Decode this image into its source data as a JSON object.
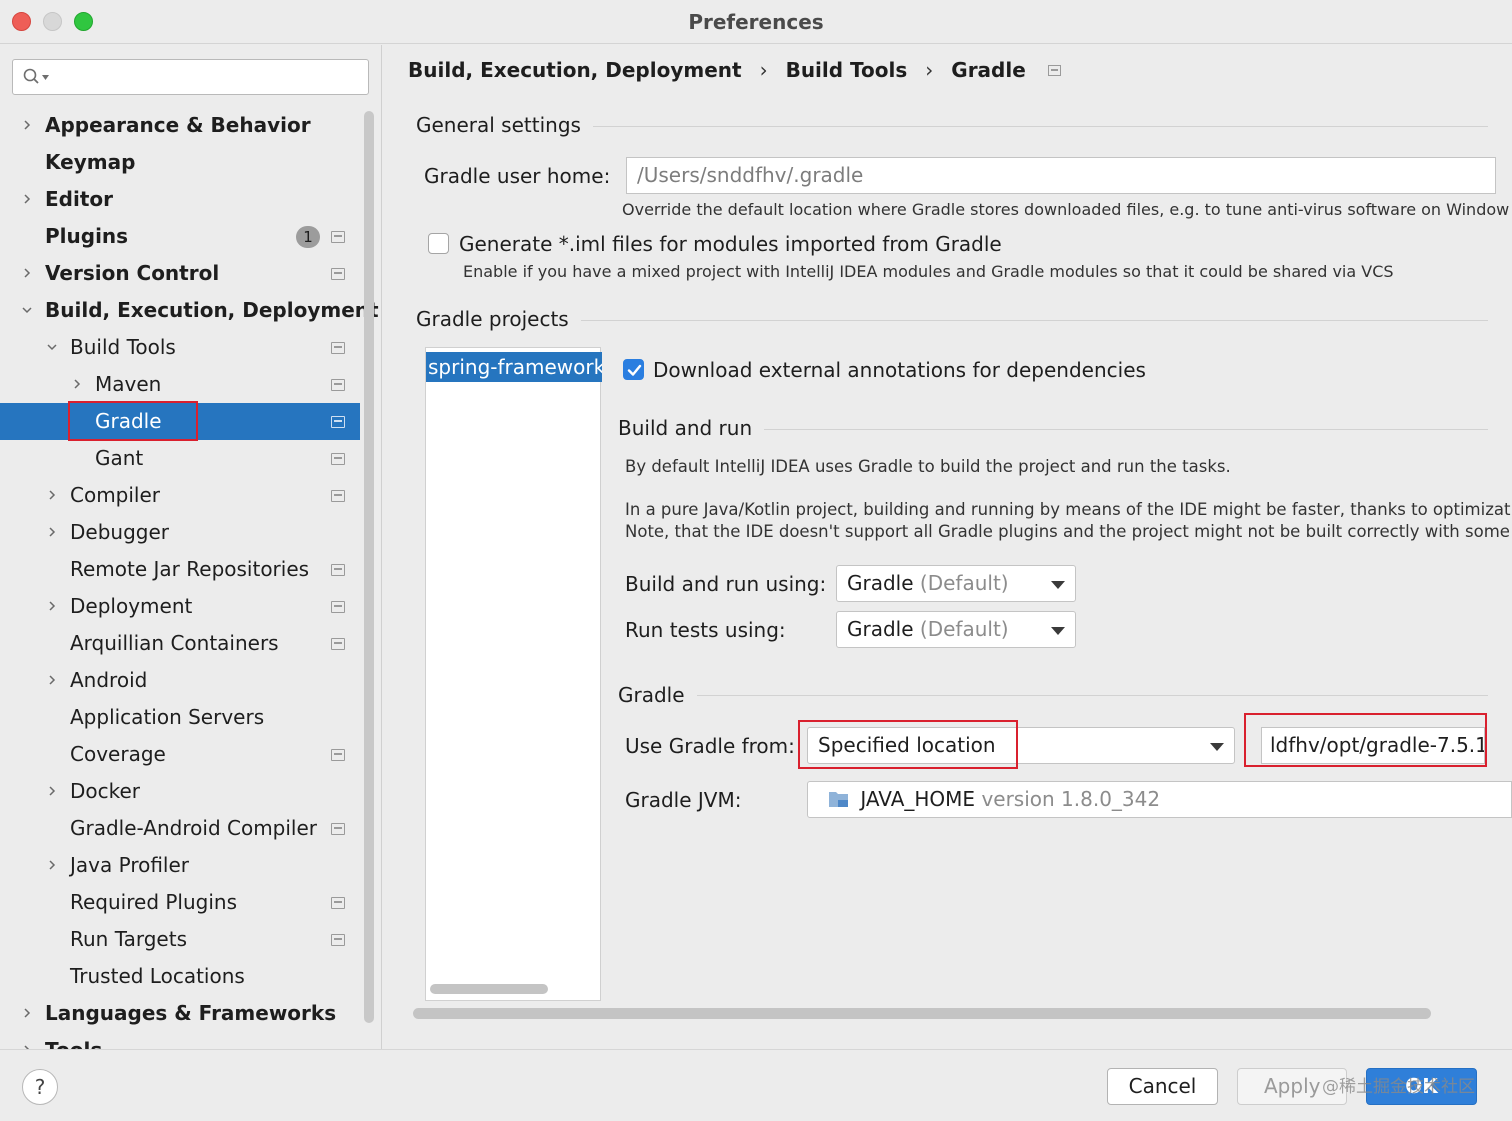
{
  "window": {
    "title": "Preferences",
    "colors": {
      "selection": "#2675bf",
      "highlight_box": "#d9202e",
      "checkbox_checked": "#2a7ee0",
      "ok_button": "#2f7fd9"
    }
  },
  "search": {
    "placeholder": "",
    "icon": "search-icon"
  },
  "sidebar": {
    "items": [
      {
        "label": "Appearance & Behavior",
        "expandable": true,
        "expanded": false,
        "bold": true,
        "indent": 0
      },
      {
        "label": "Keymap",
        "expandable": false,
        "bold": true,
        "indent": 0
      },
      {
        "label": "Editor",
        "expandable": true,
        "expanded": false,
        "bold": true,
        "indent": 0
      },
      {
        "label": "Plugins",
        "expandable": false,
        "bold": true,
        "indent": 0,
        "badge": "1",
        "config_icon": true
      },
      {
        "label": "Version Control",
        "expandable": true,
        "expanded": false,
        "bold": true,
        "indent": 0,
        "config_icon": true
      },
      {
        "label": "Build, Execution, Deployment",
        "expandable": true,
        "expanded": true,
        "bold": true,
        "indent": 0
      },
      {
        "label": "Build Tools",
        "expandable": true,
        "expanded": true,
        "indent": 1,
        "config_icon": true
      },
      {
        "label": "Maven",
        "expandable": true,
        "expanded": false,
        "indent": 2,
        "config_icon": true
      },
      {
        "label": "Gradle",
        "expandable": false,
        "indent": 2,
        "config_icon": true,
        "selected": true
      },
      {
        "label": "Gant",
        "expandable": false,
        "indent": 2,
        "config_icon": true
      },
      {
        "label": "Compiler",
        "expandable": true,
        "expanded": false,
        "indent": 1,
        "config_icon": true
      },
      {
        "label": "Debugger",
        "expandable": true,
        "expanded": false,
        "indent": 1
      },
      {
        "label": "Remote Jar Repositories",
        "expandable": false,
        "indent": 1,
        "config_icon": true
      },
      {
        "label": "Deployment",
        "expandable": true,
        "expanded": false,
        "indent": 1,
        "config_icon": true
      },
      {
        "label": "Arquillian Containers",
        "expandable": false,
        "indent": 1,
        "config_icon": true
      },
      {
        "label": "Android",
        "expandable": true,
        "expanded": false,
        "indent": 1
      },
      {
        "label": "Application Servers",
        "expandable": false,
        "indent": 1
      },
      {
        "label": "Coverage",
        "expandable": false,
        "indent": 1,
        "config_icon": true
      },
      {
        "label": "Docker",
        "expandable": true,
        "expanded": false,
        "indent": 1
      },
      {
        "label": "Gradle-Android Compiler",
        "expandable": false,
        "indent": 1,
        "config_icon": true
      },
      {
        "label": "Java Profiler",
        "expandable": true,
        "expanded": false,
        "indent": 1
      },
      {
        "label": "Required Plugins",
        "expandable": false,
        "indent": 1,
        "config_icon": true
      },
      {
        "label": "Run Targets",
        "expandable": false,
        "indent": 1,
        "config_icon": true
      },
      {
        "label": "Trusted Locations",
        "expandable": false,
        "indent": 1
      },
      {
        "label": "Languages & Frameworks",
        "expandable": true,
        "expanded": false,
        "bold": true,
        "indent": 0
      },
      {
        "label": "Tools",
        "expandable": true,
        "expanded": false,
        "bold": true,
        "indent": 0
      }
    ]
  },
  "breadcrumb": {
    "items": [
      "Build, Execution, Deployment",
      "Build Tools",
      "Gradle"
    ],
    "separator": "›"
  },
  "general": {
    "title": "General settings",
    "user_home_label": "Gradle user home:",
    "user_home_value": "/Users/snddfhv/.gradle",
    "user_home_hint": "Override the default location where Gradle stores downloaded files, e.g. to tune anti-virus software on Window",
    "iml_label": "Generate *.iml files for modules imported from Gradle",
    "iml_checked": false,
    "iml_hint": "Enable if you have a mixed project with IntelliJ IDEA modules and Gradle modules so that it could be shared via VCS"
  },
  "projects": {
    "title": "Gradle projects",
    "list": [
      "spring-framework"
    ],
    "download_annotations_label": "Download external annotations for dependencies",
    "download_annotations_checked": true,
    "build_run": {
      "title": "Build and run",
      "para1": "By default IntelliJ IDEA uses Gradle to build the project and run the tasks.",
      "para2_line1": "In a pure Java/Kotlin project, building and running by means of the IDE might be faster, thanks to optimizations",
      "para2_line2": "Note, that the IDE doesn't support all Gradle plugins and the project might not be built correctly with some of tl",
      "build_using_label": "Build and run using:",
      "build_using_value": "Gradle",
      "build_using_suffix": "(Default)",
      "tests_using_label": "Run tests using:",
      "tests_using_value": "Gradle",
      "tests_using_suffix": "(Default)"
    },
    "gradle": {
      "title": "Gradle",
      "use_from_label": "Use Gradle from:",
      "use_from_value": "Specified location",
      "location_value": "ldfhv/opt/gradle-7.5.1",
      "jvm_label": "Gradle JVM:",
      "jvm_value": "JAVA_HOME",
      "jvm_version": "version 1.8.0_342"
    }
  },
  "buttons": {
    "help": "?",
    "cancel": "Cancel",
    "apply": "Apply",
    "ok": "OK"
  },
  "watermark": "@稀土掘金技术社区"
}
